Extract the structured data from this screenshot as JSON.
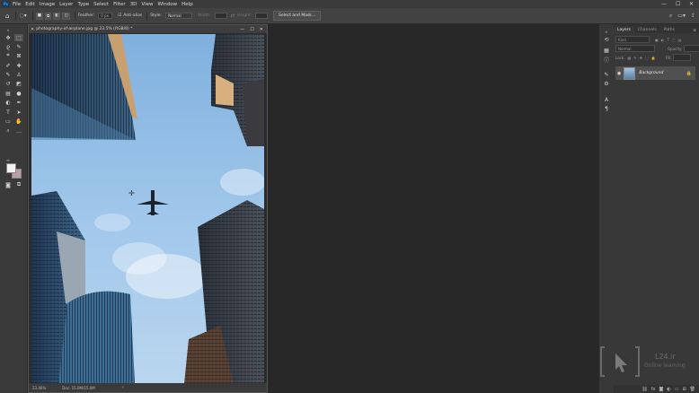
{
  "menubar": {
    "logo": "Ps",
    "items": [
      "File",
      "Edit",
      "Image",
      "Layer",
      "Type",
      "Select",
      "Filter",
      "3D",
      "View",
      "Window",
      "Help"
    ],
    "window_controls": {
      "minimize": "—",
      "maximize": "☐",
      "close": "✕"
    }
  },
  "options": {
    "feather_label": "Feather:",
    "feather_value": "0 px",
    "antialias_label": "Anti-alias",
    "style_label": "Style:",
    "style_value": "Normal",
    "width_label": "Width:",
    "height_label": "Height:",
    "select_mask_label": "Select and Mask..."
  },
  "document": {
    "title": "photography-of-airplane.jpg @ 23.5% (RGB/8) *",
    "zoom": "23.46%",
    "doc_info": "Doc: 15.0M/15.0M"
  },
  "layers_panel": {
    "tabs": [
      "Layers",
      "Channels",
      "Paths"
    ],
    "kind_placeholder": "Kind",
    "blend_mode": "Normal",
    "opacity_label": "Opacity:",
    "lock_label": "Lock:",
    "fill_label": "Fill:",
    "layer_name": "Background"
  },
  "watermark": {
    "brand": "L24.ir",
    "tagline": "Online learning"
  },
  "colors": {
    "accent": "#31a8ff",
    "app_bg": "#282828",
    "panel_bg": "#383838",
    "foreground_swatch": "#f2f2f2",
    "background_swatch": "#b9a0a8"
  }
}
